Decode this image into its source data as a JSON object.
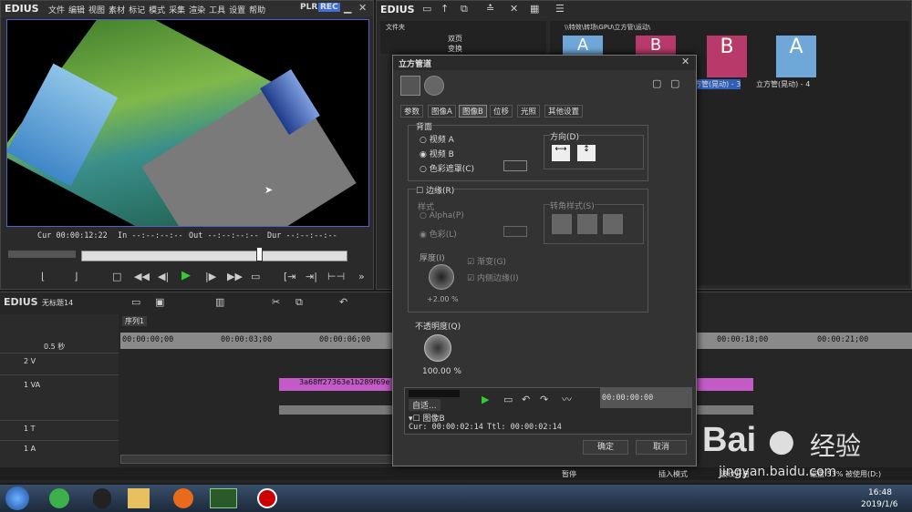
{
  "player": {
    "logo": "EDIUS",
    "menu": [
      "文件",
      "编辑",
      "视图",
      "素材",
      "标记",
      "模式",
      "采集",
      "渲染",
      "工具",
      "设置",
      "帮助"
    ],
    "plr": "PLR",
    "rec": "REC",
    "cur_label": "Cur",
    "cur": "00:00:12:22",
    "in_label": "In",
    "in": "--:--:--:--",
    "out_label": "Out",
    "out": "--:--:--:--",
    "dur_label": "Dur",
    "dur": "--:--:--:--"
  },
  "bin": {
    "logo": "EDIUS",
    "folder_header": "文件夹",
    "tree": [
      "双页",
      "变换"
    ],
    "path": "\\\\特效\\转场\\GPU\\立方管\\运动\\",
    "thumbs": [
      "A",
      "B",
      "B",
      "A"
    ],
    "thumb_labels": [
      "立方管(晃动) - 3",
      "立方管(晃动) - 4"
    ]
  },
  "dialog": {
    "title": "立方管道",
    "tabs": [
      "参数",
      "图像A",
      "图像B",
      "位移",
      "光照",
      "其他设置"
    ],
    "back_group": "背面",
    "radio_a": "视频 A",
    "radio_b": "视频 B",
    "radio_matte": "色彩遮罩(C)",
    "direction": "方向(D)",
    "border_label": "边缘(R)",
    "style": "样式",
    "alpha": "Alpha(P)",
    "color": "色彩(L)",
    "corner_style": "转角样式(S)",
    "thickness": "厚度(I)",
    "thickness_val": "+2.00 %",
    "gradient": "渐变(G)",
    "inner_border": "内侧边缘(I)",
    "opacity": "不透明度(Q)",
    "opacity_val": "100.00 %",
    "auto": "自适...",
    "preview_tc": "00:00:00:00",
    "track": "图像B",
    "cur": "Cur: 00:00:02:14",
    "ttl": "Ttl: 00:00:02:14",
    "ok": "确定",
    "cancel": "取消"
  },
  "timeline": {
    "logo": "EDIUS",
    "project": "无标题14",
    "sequence": "序列1",
    "zoom": "0.5 秒",
    "ruler": [
      "00:00:00;00",
      "00:00:03;00",
      "00:00:06;00",
      "00:00:18;00",
      "00:00:21;00"
    ],
    "tracks": [
      "2 V",
      "1 VA",
      "1 T",
      "1 A"
    ],
    "clip_name": "3a68ff27363e1b289f69e"
  },
  "status": {
    "pause": "暂停",
    "insert": "插入模式",
    "ripple": "波纹开启",
    "disk": "磁盘:53% 被使用(D:)"
  },
  "taskbar": {
    "time": "16:48",
    "date": "2019/1/6"
  },
  "watermark": {
    "brand": "Bai",
    "brand2": "经验",
    "url": "jingyan.baidu.com"
  }
}
